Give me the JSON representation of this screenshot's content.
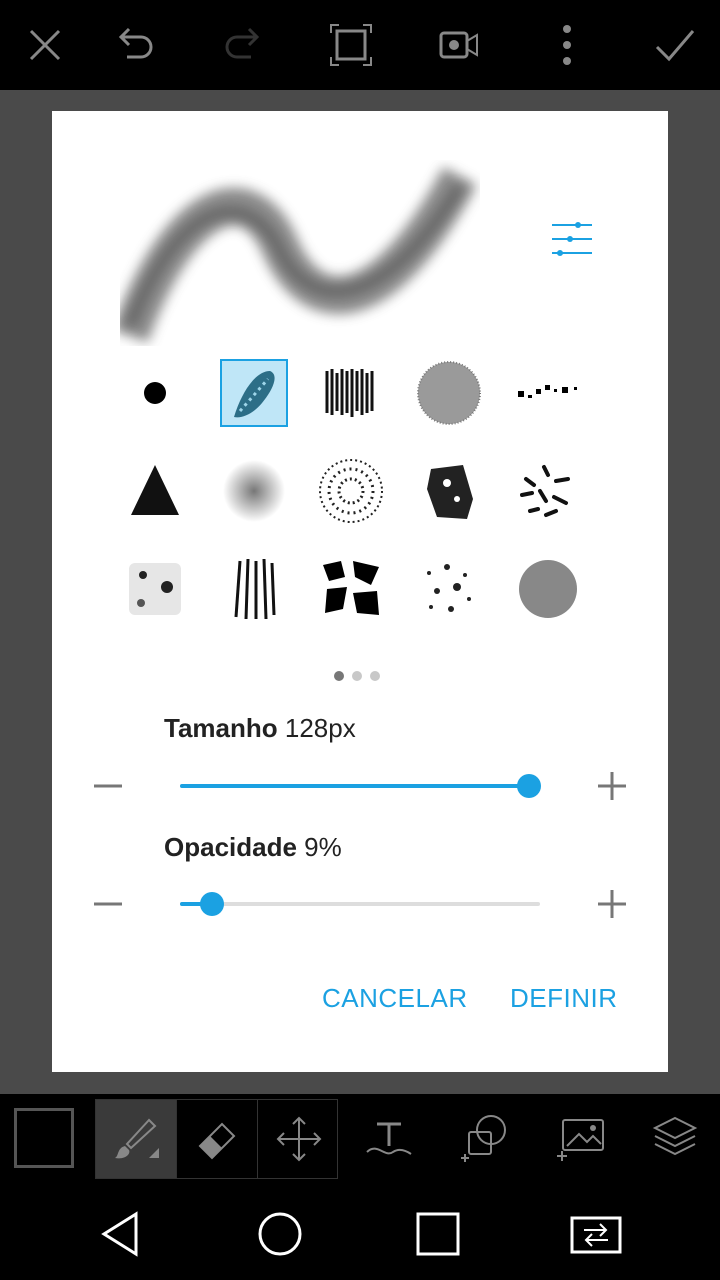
{
  "topbar": {
    "icons": [
      "close-icon",
      "undo-icon",
      "redo-icon",
      "crop-frame-icon",
      "video-camera-icon",
      "more-vertical-icon",
      "check-icon"
    ]
  },
  "dialog": {
    "brushes_selected_index": 1,
    "page_dots": 3,
    "active_page": 0,
    "size": {
      "label": "Tamanho",
      "value": "128px",
      "percent": 97
    },
    "opacity": {
      "label": "Opacidade",
      "value": "9%",
      "percent": 9
    },
    "cancel_label": "CANCELAR",
    "confirm_label": "DEFINIR"
  },
  "toolbar": {
    "icons": [
      "color-swatch",
      "brush-icon",
      "eraser-icon",
      "move-arrows-icon",
      "text-icon",
      "add-shape-icon",
      "add-photo-icon",
      "layers-icon"
    ],
    "active_tool": "brush"
  },
  "navbar": {
    "icons": [
      "back-triangle-icon",
      "home-circle-icon",
      "recents-square-icon",
      "switch-app-icon"
    ]
  },
  "colors": {
    "accent": "#1ba1e2",
    "bar": "#000000",
    "canvas_bg": "#4a4a4a"
  }
}
